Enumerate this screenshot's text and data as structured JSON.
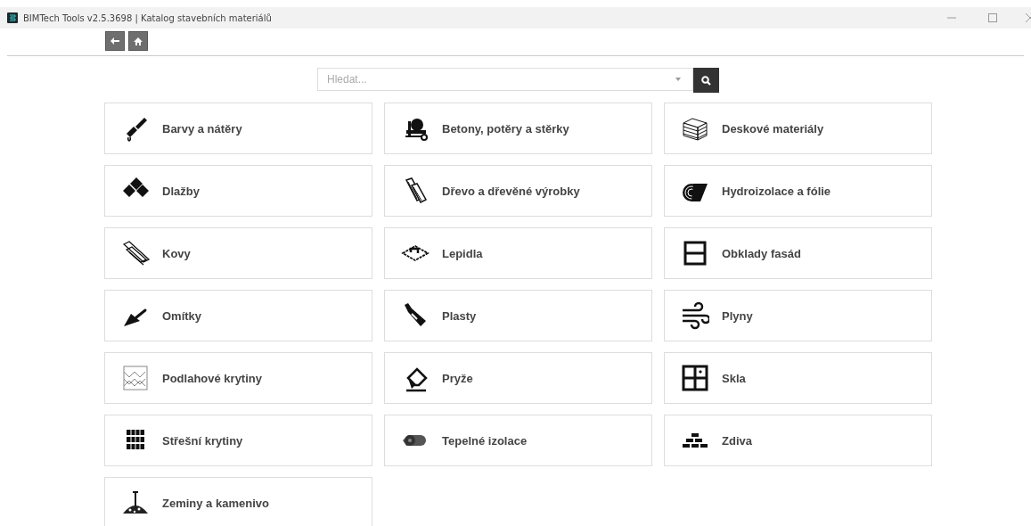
{
  "window": {
    "title": "BIMTech Tools v2.5.3698 | Katalog stavebních materiálů"
  },
  "search": {
    "placeholder": "Hledat..."
  },
  "categories": [
    {
      "label": "Barvy a nátěry"
    },
    {
      "label": "Betony, potěry a stěrky"
    },
    {
      "label": "Deskové materiály"
    },
    {
      "label": "Dlažby"
    },
    {
      "label": "Dřevo a dřevěné výrobky"
    },
    {
      "label": "Hydroizolace a fólie"
    },
    {
      "label": "Kovy"
    },
    {
      "label": "Lepidla"
    },
    {
      "label": "Obklady fasád"
    },
    {
      "label": "Omítky"
    },
    {
      "label": "Plasty"
    },
    {
      "label": "Plyny"
    },
    {
      "label": "Podlahové krytiny"
    },
    {
      "label": "Pryže"
    },
    {
      "label": "Skla"
    },
    {
      "label": "Střešní krytiny"
    },
    {
      "label": "Tepelné izolace"
    },
    {
      "label": "Zdiva"
    },
    {
      "label": "Zeminy a kamenivo"
    }
  ]
}
